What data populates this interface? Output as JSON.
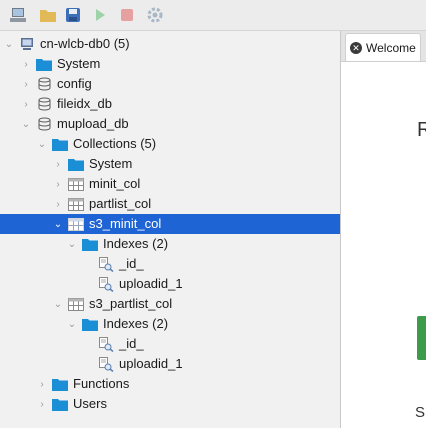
{
  "toolbar": {
    "buttons": [
      {
        "name": "connect-icon"
      },
      {
        "name": "open-folder-icon"
      },
      {
        "name": "save-icon"
      },
      {
        "name": "run-icon"
      },
      {
        "name": "stop-icon"
      },
      {
        "name": "settings-icon"
      }
    ]
  },
  "tree": {
    "connection": "cn-wlcb-db0 (5)",
    "system": "System",
    "config": "config",
    "fileidx_db": "fileidx_db",
    "mupload_db": "mupload_db",
    "collections": "Collections (5)",
    "collections_system": "System",
    "minit_col": "minit_col",
    "partlist_col": "partlist_col",
    "s3_minit_col": "s3_minit_col",
    "s3_minit_indexes": "Indexes (2)",
    "s3_minit_id": "_id_",
    "s3_minit_uploadid": "uploadid_1",
    "s3_partlist_col": "s3_partlist_col",
    "s3_partlist_indexes": "Indexes (2)",
    "s3_partlist_id": "_id_",
    "s3_partlist_uploadid": "uploadid_1",
    "functions": "Functions",
    "users": "Users"
  },
  "pane": {
    "tab_label": "Welcome",
    "heading_fragment": "R",
    "footer_fragment": "S"
  },
  "colors": {
    "selection": "#1f64d4",
    "folder": "#1a8fd6",
    "green_button": "#3c9c4c"
  }
}
